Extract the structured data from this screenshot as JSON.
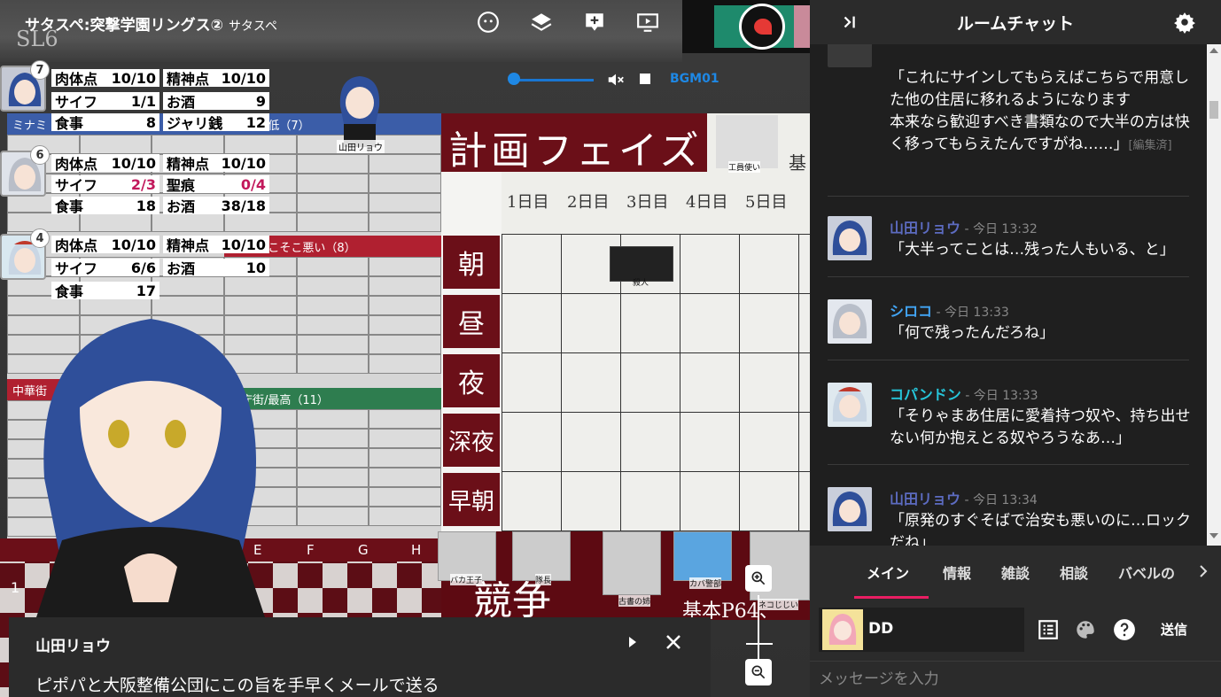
{
  "room": {
    "title": "サタスペ:突撃学園リングス②",
    "subtitle": "サタスペ",
    "watermark": "SL6"
  },
  "bgm": {
    "label": "BGM01",
    "volume": 0.05
  },
  "status_panels": [
    {
      "badge": "7",
      "stats": [
        {
          "label": "肉体点",
          "value": "10/10"
        },
        {
          "label": "精神点",
          "value": "10/10"
        },
        {
          "label": "サイフ",
          "value": "1/1"
        },
        {
          "label": "お酒",
          "value": "9"
        },
        {
          "label": "食事",
          "value": "8"
        },
        {
          "label": "ジャリ銭",
          "value": "12"
        }
      ]
    },
    {
      "badge": "6",
      "stats": [
        {
          "label": "肉体点",
          "value": "10/10"
        },
        {
          "label": "精神点",
          "value": "10/10"
        },
        {
          "label": "サイフ",
          "value": "2/3"
        },
        {
          "label": "聖痕",
          "value": "0/4"
        },
        {
          "label": "食事",
          "value": "18"
        },
        {
          "label": "お酒",
          "value": "38/18"
        }
      ]
    },
    {
      "badge": "4",
      "stats": [
        {
          "label": "肉体点",
          "value": "10/10"
        },
        {
          "label": "精神点",
          "value": "10/10"
        },
        {
          "label": "サイフ",
          "value": "6/6"
        },
        {
          "label": "お酒",
          "value": "10"
        },
        {
          "label": "食事",
          "value": "17"
        }
      ]
    }
  ],
  "map": {
    "wards": {
      "minami": "ミナミ",
      "chian": "治安/最低（7）",
      "sogai": "治安/そこそこ悪い（8）",
      "chuka": "中華街",
      "kancho": "官庁街/最高（11）"
    },
    "cutin_name": "山田リョウ",
    "soldier_label": "工員使い"
  },
  "phase": {
    "title": "計画フェイズ",
    "ref": "基",
    "days": [
      "1日目",
      "2日目",
      "3日目",
      "4日目",
      "5日目"
    ],
    "slots": [
      "朝",
      "昼",
      "夜",
      "深夜",
      "早朝"
    ],
    "token_label": "殺人"
  },
  "checker": {
    "columns": [
      "E",
      "F",
      "G",
      "H"
    ],
    "row": "1"
  },
  "kyoso": {
    "title": "競争",
    "ref": "基本P64、"
  },
  "portrait_labels": [
    "バカ王子",
    "隊長",
    "古書の姉",
    "カバ警部",
    "ネコじじい"
  ],
  "dialog": {
    "speaker": "山田リョウ",
    "text": "ピポパと大阪整備公団にこの旨を手早くメールで送る"
  },
  "chat": {
    "title": "ルームチャット",
    "messages": [
      {
        "name": "",
        "time": "",
        "color": "#5c6bc0",
        "lines": [
          "「これにサインしてもらえばこちらで用意した他の住居に移れるようになります",
          "本来なら歓迎すべき書類なので大半の方は快く移ってもらえたんですがね……」"
        ],
        "edited": "[編集済]"
      },
      {
        "name": "山田リョウ",
        "time": "今日 13:32",
        "color": "#5c6bc0",
        "lines": [
          "「大半ってことは…残った人もいる、と」"
        ]
      },
      {
        "name": "シロコ",
        "time": "今日 13:33",
        "color": "#42a5f5",
        "lines": [
          "「何で残ったんだろね」"
        ]
      },
      {
        "name": "コパンドン",
        "time": "今日 13:33",
        "color": "#26c6da",
        "lines": [
          "「そりゃまあ住居に愛着持つ奴や、持ち出せない何か抱えとる奴やろうなあ…」"
        ]
      },
      {
        "name": "山田リョウ",
        "time": "今日 13:34",
        "color": "#5c6bc0",
        "lines": [
          "「原発のすぐそばで治安も悪いのに…ロックだね」"
        ]
      }
    ],
    "tabs": [
      "メイン",
      "情報",
      "雑談",
      "相談",
      "バベルの"
    ],
    "active_tab": "メイン",
    "character": "DD",
    "send_label": "送信",
    "input_placeholder": "メッセージを入力"
  },
  "colors": {
    "accent": "#e91e63",
    "bgm": "#1e88e5",
    "phase": "#6b0f18"
  }
}
